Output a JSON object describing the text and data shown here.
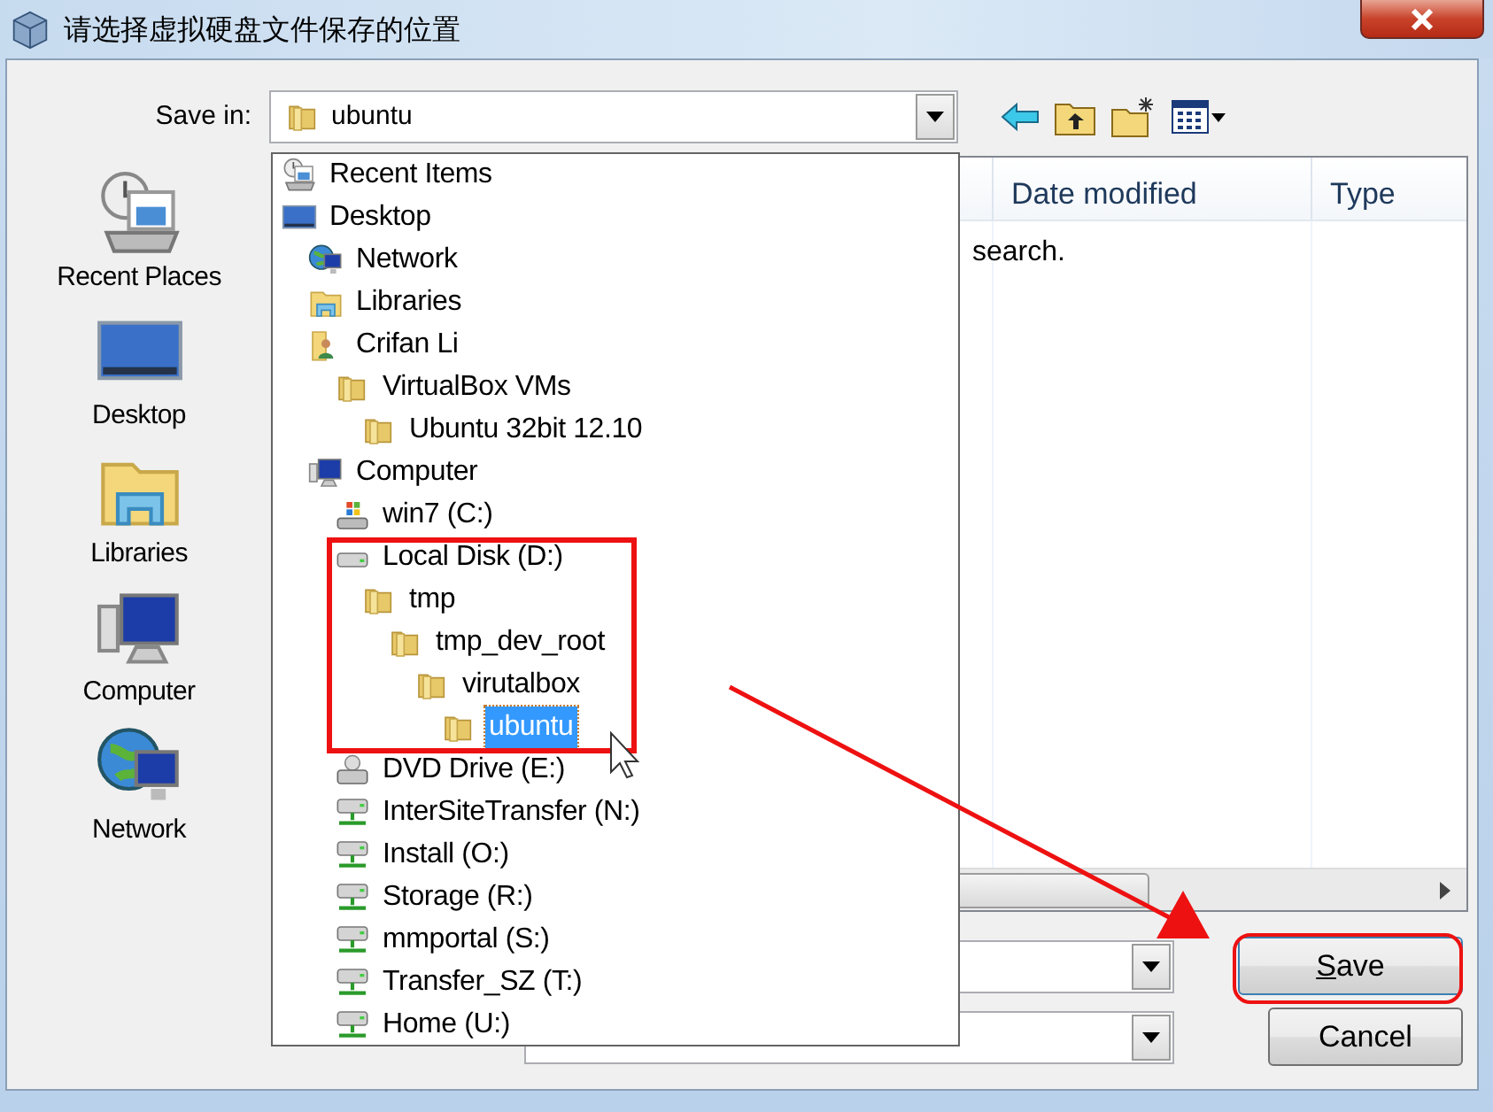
{
  "window": {
    "title": "请选择虚拟硬盘文件保存的位置"
  },
  "save_in": {
    "label": "Save in:",
    "value": "ubuntu"
  },
  "places": [
    {
      "kind": "recent",
      "label": "Recent Places"
    },
    {
      "kind": "desktop",
      "label": "Desktop"
    },
    {
      "kind": "libraries",
      "label": "Libraries"
    },
    {
      "kind": "computer",
      "label": "Computer"
    },
    {
      "kind": "network",
      "label": "Network"
    }
  ],
  "file_list": {
    "columns": [
      "Date modified",
      "Type"
    ],
    "message": "search."
  },
  "location_dropdown": {
    "expanded": true,
    "items": [
      {
        "kind": "recent",
        "label": "Recent Items",
        "selected": false
      },
      {
        "kind": "desktop",
        "label": "Desktop",
        "selected": false,
        "children": [
          {
            "kind": "network",
            "label": "Network",
            "selected": false
          },
          {
            "kind": "libraries",
            "label": "Libraries",
            "selected": false
          },
          {
            "kind": "user",
            "label": "Crifan Li",
            "selected": false,
            "children": [
              {
                "kind": "folder",
                "label": "VirtualBox VMs",
                "selected": false,
                "children": [
                  {
                    "kind": "folder",
                    "label": "Ubuntu 32bit 12.10",
                    "selected": false
                  }
                ]
              }
            ]
          },
          {
            "kind": "computer",
            "label": "Computer",
            "selected": false,
            "children": [
              {
                "kind": "system-drive",
                "label": "win7 (C:)",
                "selected": false
              },
              {
                "kind": "disk",
                "label": "Local Disk (D:)",
                "selected": false,
                "children": [
                  {
                    "kind": "folder",
                    "label": "tmp",
                    "selected": false,
                    "children": [
                      {
                        "kind": "folder",
                        "label": "tmp_dev_root",
                        "selected": false,
                        "children": [
                          {
                            "kind": "folder",
                            "label": "virutalbox",
                            "selected": false,
                            "children": [
                              {
                                "kind": "folder",
                                "label": "ubuntu",
                                "selected": true
                              }
                            ]
                          }
                        ]
                      }
                    ]
                  }
                ]
              },
              {
                "kind": "dvd",
                "label": "DVD Drive (E:)",
                "selected": false
              },
              {
                "kind": "network-drive",
                "label": "InterSiteTransfer (N:)",
                "selected": false
              },
              {
                "kind": "network-drive",
                "label": "Install (O:)",
                "selected": false
              },
              {
                "kind": "network-drive",
                "label": "Storage (R:)",
                "selected": false
              },
              {
                "kind": "network-drive",
                "label": "mmportal (S:)",
                "selected": false
              },
              {
                "kind": "network-drive",
                "label": "Transfer_SZ (T:)",
                "selected": false
              },
              {
                "kind": "network-drive",
                "label": "Home (U:)",
                "selected": false
              }
            ]
          }
        ]
      }
    ]
  },
  "buttons": [
    {
      "kind": "save",
      "label": "Save"
    },
    {
      "kind": "cancel",
      "label": "Cancel"
    }
  ]
}
